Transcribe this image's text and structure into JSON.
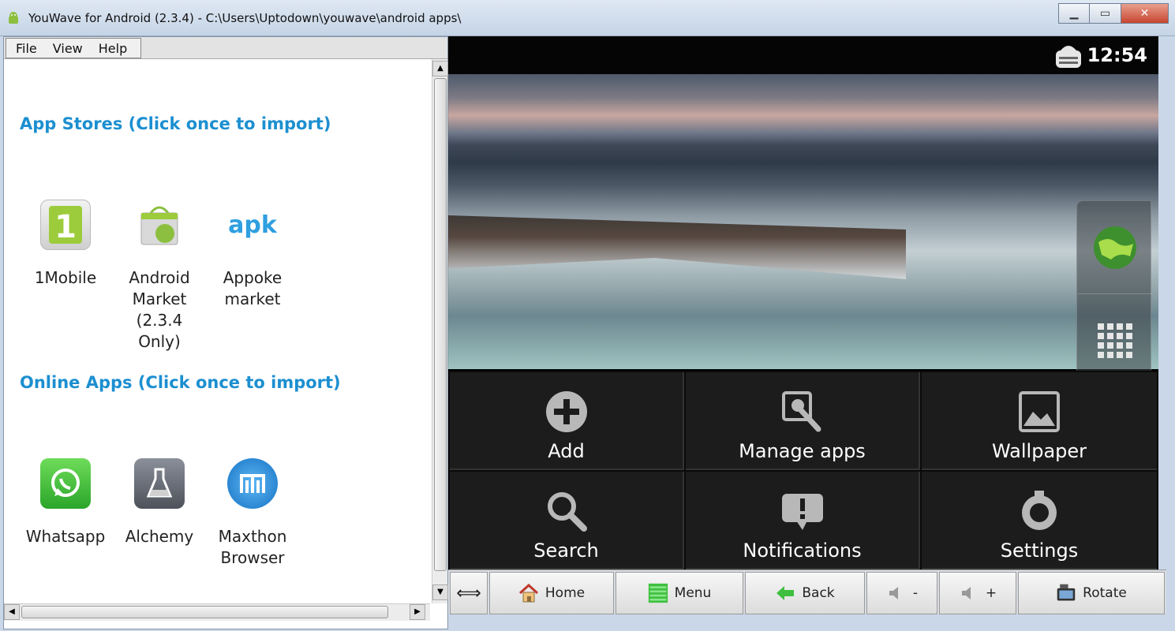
{
  "window": {
    "title": "YouWave for Android (2.3.4) - C:\\Users\\Uptodown\\youwave\\android apps\\",
    "minimize_icon": "minimize-icon",
    "maximize_icon": "maximize-icon",
    "close_icon": "close-icon"
  },
  "menu": {
    "file": "File",
    "view": "View",
    "help": "Help"
  },
  "sections": {
    "app_stores": "App Stores (Click once to import)",
    "online_apps": "Online Apps (Click once to import)"
  },
  "app_stores": [
    {
      "label": "1Mobile",
      "icon": "1mobile-icon"
    },
    {
      "label": "Android\nMarket\n(2.3.4\nOnly)",
      "icon": "android-market-icon"
    },
    {
      "label": "Appoke\nmarket",
      "icon": "apk-icon",
      "icon_text": "apk"
    }
  ],
  "online_apps": [
    {
      "label": "Whatsapp",
      "icon": "whatsapp-icon"
    },
    {
      "label": "Alchemy",
      "icon": "alchemy-icon"
    },
    {
      "label": "Maxthon\nBrowser",
      "icon": "maxthon-icon"
    }
  ],
  "emulator": {
    "clock": "12:54",
    "options": [
      {
        "label": "Add",
        "icon": "add-icon"
      },
      {
        "label": "Manage apps",
        "icon": "manage-apps-icon"
      },
      {
        "label": "Wallpaper",
        "icon": "wallpaper-icon"
      },
      {
        "label": "Search",
        "icon": "search-icon"
      },
      {
        "label": "Notifications",
        "icon": "notifications-icon"
      },
      {
        "label": "Settings",
        "icon": "settings-icon"
      }
    ]
  },
  "toolbar": {
    "home": "Home",
    "menu": "Menu",
    "back": "Back",
    "vol_down": "-",
    "vol_up": "+",
    "rotate": "Rotate"
  },
  "colors": {
    "section_title": "#1c8fd0",
    "menu_bg": "#1c1c1c"
  }
}
